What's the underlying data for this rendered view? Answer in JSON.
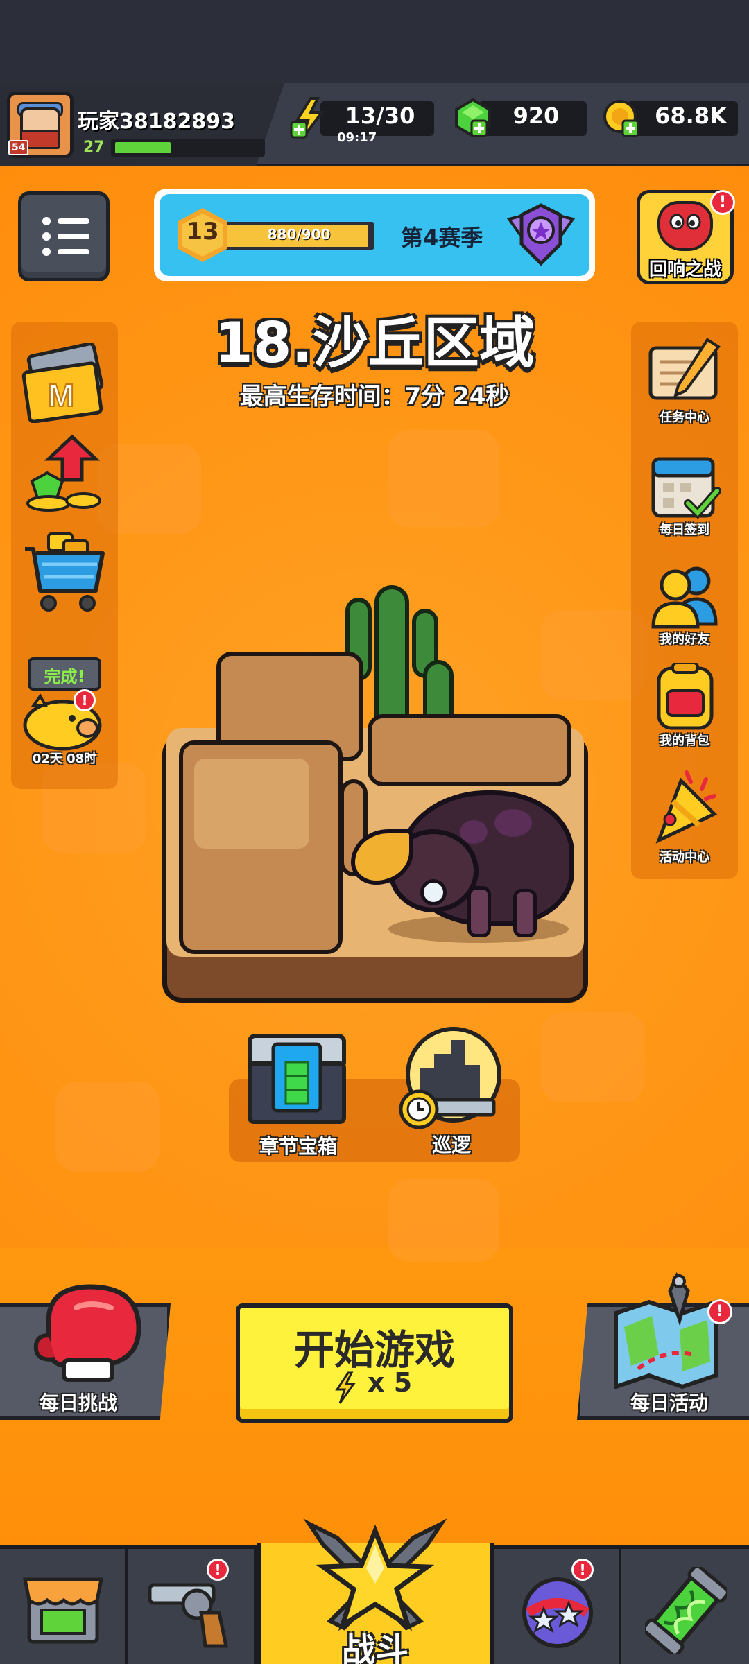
{
  "player": {
    "name": "玩家38182893",
    "level": "27",
    "avatar_badge": "54",
    "xp_fraction": 0.38
  },
  "resources": {
    "energy": "13/30",
    "energy_timer": "09:17",
    "gems": "920",
    "coins": "68.8K"
  },
  "season": {
    "level": "13",
    "progress": "880/900",
    "progress_fraction": 0.978,
    "name": "第4赛季"
  },
  "echo_battle": {
    "label": "回响之战",
    "badge": "!"
  },
  "stage": {
    "title": "18.沙丘区域",
    "best_survival": "最高生存时间：7分 24秒"
  },
  "left_panel": {
    "piggy_status": "完成!",
    "piggy_timer": "02天 08时",
    "piggy_badge": "!"
  },
  "right_panel": {
    "items": [
      {
        "label": "任务中心",
        "icon": "scroll-quill-icon"
      },
      {
        "label": "每日签到",
        "icon": "calendar-check-icon"
      },
      {
        "label": "我的好友",
        "icon": "friends-icon"
      },
      {
        "label": "我的背包",
        "icon": "backpack-icon"
      },
      {
        "label": "活动中心",
        "icon": "party-horn-icon"
      }
    ]
  },
  "stage_actions": {
    "chest_label": "章节宝箱",
    "patrol_label": "巡逻"
  },
  "actions": {
    "daily_challenge": "每日挑战",
    "start_game": "开始游戏",
    "start_cost": "x 5",
    "daily_event": "每日活动",
    "daily_event_badge": "!"
  },
  "tabs": {
    "active_label": "战斗",
    "weapon_badge": "!",
    "talent_badge": "!"
  },
  "colors": {
    "field_orange": "#ff9514",
    "start_yellow": "#fff23d",
    "alert_red": "#e8283c"
  }
}
